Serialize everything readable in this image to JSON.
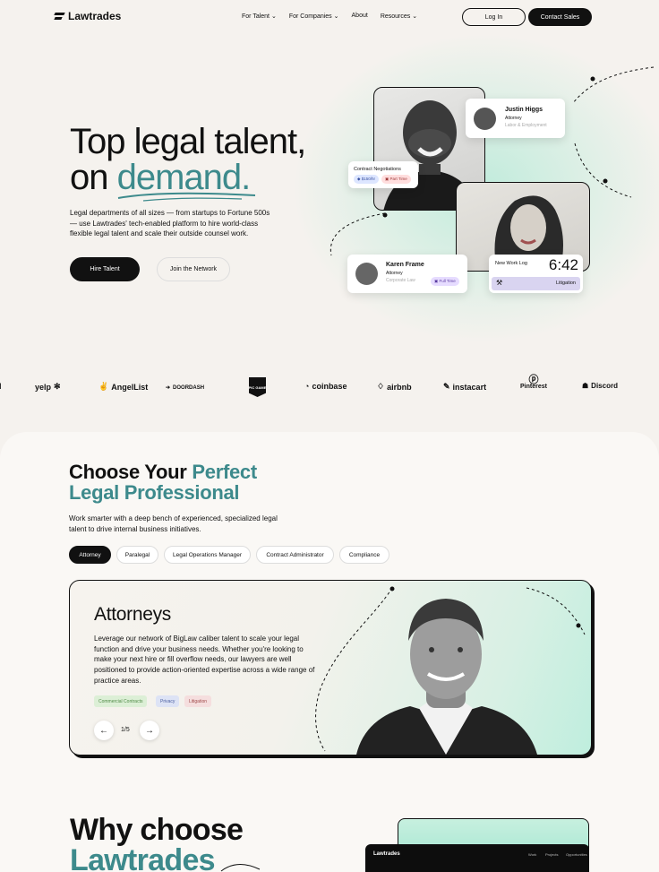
{
  "nav": {
    "logo": "Lawtrades",
    "menu": [
      "For Talent",
      "For Companies",
      "About",
      "Resources"
    ],
    "login": "Log In",
    "contact_sales": "Contact Sales"
  },
  "hero": {
    "title_line1": "Top legal talent,",
    "title_line2a": "on ",
    "title_line2b": "demand.",
    "description": "Legal departments of all sizes — from startups to Fortune 500s — use Lawtrades' tech-enabled platform to hire world-class flexible legal talent and scale their outside counsel work.",
    "hire_button": "Hire Talent",
    "join_button": "Join the Network",
    "card_justin": {
      "name": "Justin Higgs",
      "role": "Attorney",
      "area": "Labor & Employment"
    },
    "card_contract": {
      "title": "Contract Negotiations",
      "rate": "$150/hr",
      "type": "Part Time"
    },
    "card_karen": {
      "name": "Karen Frame",
      "role": "Attorney",
      "area": "Corporate Law",
      "type": "Full Time"
    },
    "card_log": {
      "title": "New Work Log",
      "time": "6:42",
      "category": "Litigation"
    }
  },
  "logos": [
    "yelp",
    "AngelList",
    "DOORDASH",
    "EPIC GAMES",
    "coinbase",
    "airbnb",
    "instacart",
    "Pinterest",
    "Discord"
  ],
  "section2": {
    "title_line1a": "Choose Your ",
    "title_line1b": "Perfect",
    "title_line2": "Legal Professional",
    "description": "Work smarter with a deep bench of experienced, specialized legal talent to drive internal business initiatives.",
    "tabs": [
      "Attorney",
      "Paralegal",
      "Legal Operations Manager",
      "Contract Administrator",
      "Compliance"
    ],
    "feature": {
      "title": "Attorneys",
      "description": "Leverage our network of BigLaw caliber talent to scale your legal function and drive your business needs. Whether you're looking to make your next hire or fill overflow needs, our lawyers are well positioned to provide action-oriented expertise across a wide range of practice areas.",
      "tags": [
        "Commercial Contracts",
        "Privacy",
        "Litigation"
      ],
      "pager": "1/5"
    }
  },
  "section3": {
    "title_line1": "Why choose",
    "title_line2": "Lawtrades",
    "mock_logo": "Lawtrades",
    "mock_menu": [
      "Work",
      "Projects",
      "Opportunities"
    ]
  },
  "colors": {
    "accent": "#3d8a8c",
    "background": "#f5f2ee",
    "dark": "#111111",
    "mint": "#bfeede"
  }
}
